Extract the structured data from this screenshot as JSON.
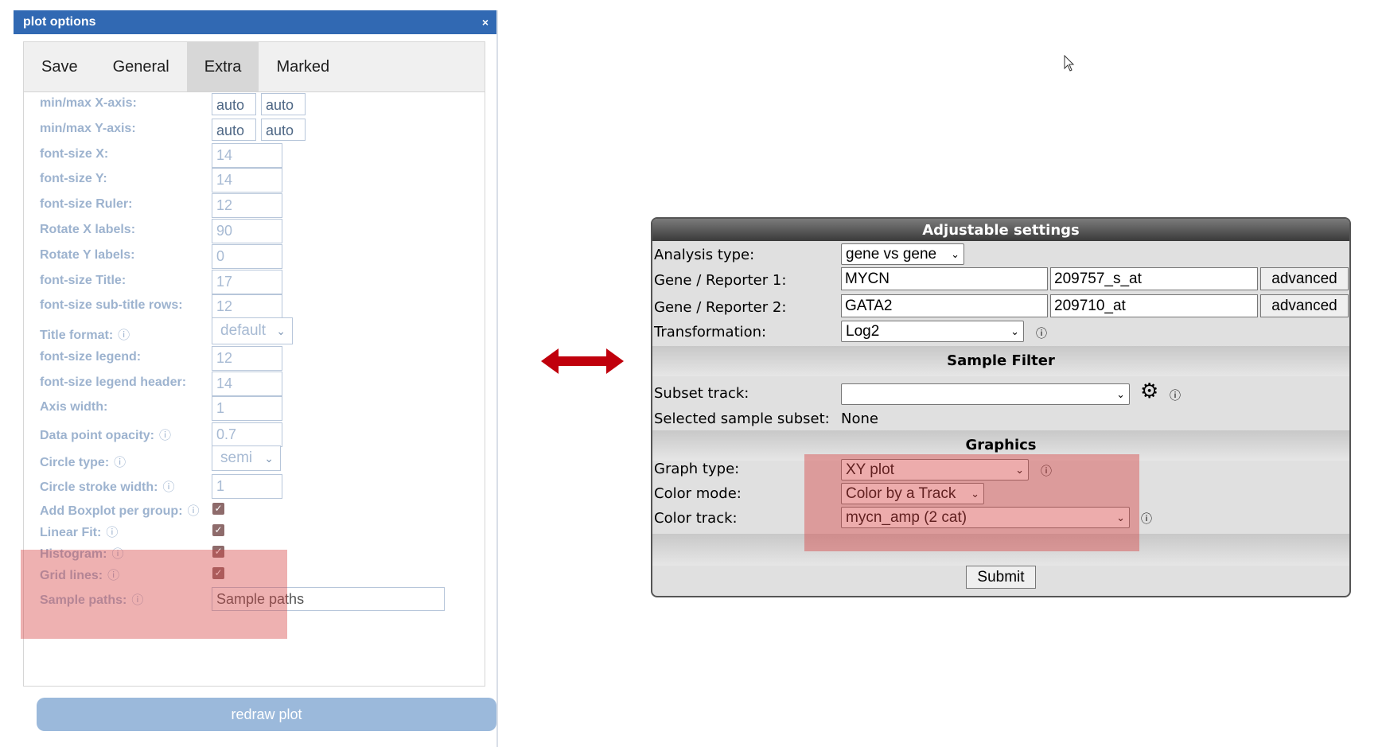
{
  "left_dialog": {
    "title": "plot options",
    "close": "×",
    "tabs": [
      {
        "label": "Save",
        "active": false
      },
      {
        "label": "General",
        "active": false
      },
      {
        "label": "Extra",
        "active": true
      },
      {
        "label": "Marked",
        "active": false
      }
    ],
    "fields": {
      "min_max_x": {
        "label": "min/max X-axis:",
        "min": "auto",
        "max": "auto"
      },
      "min_max_y": {
        "label": "min/max Y-axis:",
        "min": "auto",
        "max": "auto"
      },
      "font_size_x": {
        "label": "font-size X:",
        "value": "14"
      },
      "font_size_y": {
        "label": "font-size Y:",
        "value": "14"
      },
      "font_size_ruler": {
        "label": "font-size Ruler:",
        "value": "12"
      },
      "rotate_x": {
        "label": "Rotate X labels:",
        "value": "90"
      },
      "rotate_y": {
        "label": "Rotate Y labels:",
        "value": "0"
      },
      "font_size_title": {
        "label": "font-size Title:",
        "value": "17"
      },
      "font_size_subtitle": {
        "label": "font-size sub-title rows:",
        "value": "12"
      },
      "title_format": {
        "label": "Title format:",
        "value": "default"
      },
      "font_size_legend": {
        "label": "font-size legend:",
        "value": "12"
      },
      "font_size_legend_header": {
        "label": "font-size legend header:",
        "value": "14"
      },
      "axis_width": {
        "label": "Axis width:",
        "value": "1"
      },
      "data_point_opacity": {
        "label": "Data point opacity:",
        "value": "0.7"
      },
      "circle_type": {
        "label": "Circle type:",
        "value": "semi"
      },
      "circle_stroke_width": {
        "label": "Circle stroke width:",
        "value": "1"
      },
      "add_boxplot": {
        "label": "Add Boxplot per group:",
        "checked": true
      },
      "linear_fit": {
        "label": "Linear Fit:",
        "checked": true
      },
      "histogram": {
        "label": "Histogram:",
        "checked": true
      },
      "grid_lines": {
        "label": "Grid lines:",
        "checked": true
      },
      "sample_paths": {
        "label": "Sample paths:",
        "placeholder": "Sample paths"
      }
    },
    "info_glyph": "ⓘ",
    "check_glyph": "✓",
    "chevron": "⌄",
    "redraw_label": "redraw plot"
  },
  "right_panel": {
    "title": "Adjustable settings",
    "analysis_type": {
      "label": "Analysis type:",
      "value": "gene vs gene"
    },
    "gene1": {
      "label": "Gene / Reporter 1:",
      "gene": "MYCN",
      "reporter": "209757_s_at",
      "button": "advanced"
    },
    "gene2": {
      "label": "Gene / Reporter 2:",
      "gene": "GATA2",
      "reporter": "209710_at",
      "button": "advanced"
    },
    "transformation": {
      "label": "Transformation:",
      "value": "Log2"
    },
    "sample_filter_header": "Sample Filter",
    "subset_track": {
      "label": "Subset track:",
      "value": ""
    },
    "selected_subset": {
      "label": "Selected sample subset:",
      "value": "None"
    },
    "graphics_header": "Graphics",
    "graph_type": {
      "label": "Graph type:",
      "value": "XY plot"
    },
    "color_mode": {
      "label": "Color mode:",
      "value": "Color by a Track"
    },
    "color_track": {
      "label": "Color track:",
      "value": "mycn_amp (2 cat)"
    },
    "submit_label": "Submit",
    "gear_glyph": "⚙",
    "info_glyph": "ⓘ"
  },
  "colors": {
    "title_bar": "#3169b3",
    "highlight": "#d64646",
    "arrow": "#c0000c",
    "redraw": "#9bb9db"
  }
}
